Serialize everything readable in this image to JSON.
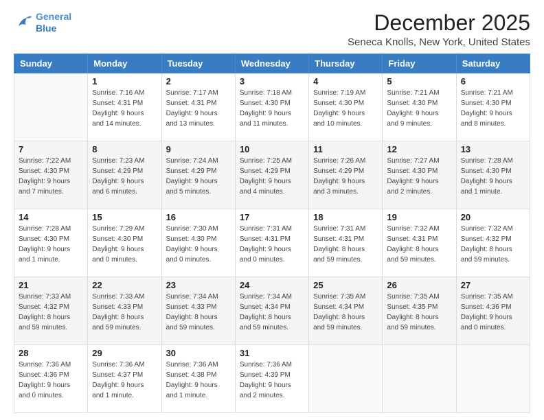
{
  "logo": {
    "line1": "General",
    "line2": "Blue"
  },
  "header": {
    "month": "December 2025",
    "location": "Seneca Knolls, New York, United States"
  },
  "weekdays": [
    "Sunday",
    "Monday",
    "Tuesday",
    "Wednesday",
    "Thursday",
    "Friday",
    "Saturday"
  ],
  "weeks": [
    [
      {
        "day": "",
        "info": ""
      },
      {
        "day": "1",
        "info": "Sunrise: 7:16 AM\nSunset: 4:31 PM\nDaylight: 9 hours\nand 14 minutes."
      },
      {
        "day": "2",
        "info": "Sunrise: 7:17 AM\nSunset: 4:31 PM\nDaylight: 9 hours\nand 13 minutes."
      },
      {
        "day": "3",
        "info": "Sunrise: 7:18 AM\nSunset: 4:30 PM\nDaylight: 9 hours\nand 11 minutes."
      },
      {
        "day": "4",
        "info": "Sunrise: 7:19 AM\nSunset: 4:30 PM\nDaylight: 9 hours\nand 10 minutes."
      },
      {
        "day": "5",
        "info": "Sunrise: 7:21 AM\nSunset: 4:30 PM\nDaylight: 9 hours\nand 9 minutes."
      },
      {
        "day": "6",
        "info": "Sunrise: 7:21 AM\nSunset: 4:30 PM\nDaylight: 9 hours\nand 8 minutes."
      }
    ],
    [
      {
        "day": "7",
        "info": "Sunrise: 7:22 AM\nSunset: 4:30 PM\nDaylight: 9 hours\nand 7 minutes."
      },
      {
        "day": "8",
        "info": "Sunrise: 7:23 AM\nSunset: 4:29 PM\nDaylight: 9 hours\nand 6 minutes."
      },
      {
        "day": "9",
        "info": "Sunrise: 7:24 AM\nSunset: 4:29 PM\nDaylight: 9 hours\nand 5 minutes."
      },
      {
        "day": "10",
        "info": "Sunrise: 7:25 AM\nSunset: 4:29 PM\nDaylight: 9 hours\nand 4 minutes."
      },
      {
        "day": "11",
        "info": "Sunrise: 7:26 AM\nSunset: 4:29 PM\nDaylight: 9 hours\nand 3 minutes."
      },
      {
        "day": "12",
        "info": "Sunrise: 7:27 AM\nSunset: 4:30 PM\nDaylight: 9 hours\nand 2 minutes."
      },
      {
        "day": "13",
        "info": "Sunrise: 7:28 AM\nSunset: 4:30 PM\nDaylight: 9 hours\nand 1 minute."
      }
    ],
    [
      {
        "day": "14",
        "info": "Sunrise: 7:28 AM\nSunset: 4:30 PM\nDaylight: 9 hours\nand 1 minute."
      },
      {
        "day": "15",
        "info": "Sunrise: 7:29 AM\nSunset: 4:30 PM\nDaylight: 9 hours\nand 0 minutes."
      },
      {
        "day": "16",
        "info": "Sunrise: 7:30 AM\nSunset: 4:30 PM\nDaylight: 9 hours\nand 0 minutes."
      },
      {
        "day": "17",
        "info": "Sunrise: 7:31 AM\nSunset: 4:31 PM\nDaylight: 9 hours\nand 0 minutes."
      },
      {
        "day": "18",
        "info": "Sunrise: 7:31 AM\nSunset: 4:31 PM\nDaylight: 8 hours\nand 59 minutes."
      },
      {
        "day": "19",
        "info": "Sunrise: 7:32 AM\nSunset: 4:31 PM\nDaylight: 8 hours\nand 59 minutes."
      },
      {
        "day": "20",
        "info": "Sunrise: 7:32 AM\nSunset: 4:32 PM\nDaylight: 8 hours\nand 59 minutes."
      }
    ],
    [
      {
        "day": "21",
        "info": "Sunrise: 7:33 AM\nSunset: 4:32 PM\nDaylight: 8 hours\nand 59 minutes."
      },
      {
        "day": "22",
        "info": "Sunrise: 7:33 AM\nSunset: 4:33 PM\nDaylight: 8 hours\nand 59 minutes."
      },
      {
        "day": "23",
        "info": "Sunrise: 7:34 AM\nSunset: 4:33 PM\nDaylight: 8 hours\nand 59 minutes."
      },
      {
        "day": "24",
        "info": "Sunrise: 7:34 AM\nSunset: 4:34 PM\nDaylight: 8 hours\nand 59 minutes."
      },
      {
        "day": "25",
        "info": "Sunrise: 7:35 AM\nSunset: 4:34 PM\nDaylight: 8 hours\nand 59 minutes."
      },
      {
        "day": "26",
        "info": "Sunrise: 7:35 AM\nSunset: 4:35 PM\nDaylight: 8 hours\nand 59 minutes."
      },
      {
        "day": "27",
        "info": "Sunrise: 7:35 AM\nSunset: 4:36 PM\nDaylight: 9 hours\nand 0 minutes."
      }
    ],
    [
      {
        "day": "28",
        "info": "Sunrise: 7:36 AM\nSunset: 4:36 PM\nDaylight: 9 hours\nand 0 minutes."
      },
      {
        "day": "29",
        "info": "Sunrise: 7:36 AM\nSunset: 4:37 PM\nDaylight: 9 hours\nand 1 minute."
      },
      {
        "day": "30",
        "info": "Sunrise: 7:36 AM\nSunset: 4:38 PM\nDaylight: 9 hours\nand 1 minute."
      },
      {
        "day": "31",
        "info": "Sunrise: 7:36 AM\nSunset: 4:39 PM\nDaylight: 9 hours\nand 2 minutes."
      },
      {
        "day": "",
        "info": ""
      },
      {
        "day": "",
        "info": ""
      },
      {
        "day": "",
        "info": ""
      }
    ]
  ]
}
